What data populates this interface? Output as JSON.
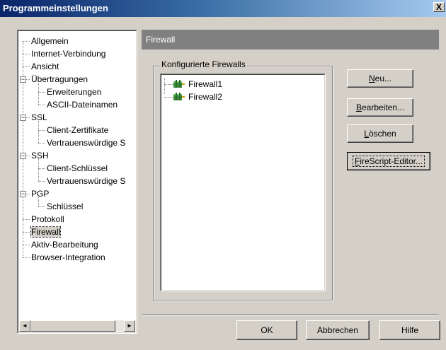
{
  "window": {
    "title": "Programmeinstellungen",
    "close_glyph": "X"
  },
  "tree": {
    "items": [
      {
        "label": "Allgemein"
      },
      {
        "label": "Internet-Verbindung"
      },
      {
        "label": "Ansicht"
      },
      {
        "label": "Übertragungen",
        "expander": "−"
      },
      {
        "label": "Erweiterungen"
      },
      {
        "label": "ASCII-Dateinamen"
      },
      {
        "label": "SSL",
        "expander": "−"
      },
      {
        "label": "Client-Zertifikate"
      },
      {
        "label": "Vertrauenswürdige S"
      },
      {
        "label": "SSH",
        "expander": "−"
      },
      {
        "label": "Client-Schlüssel"
      },
      {
        "label": "Vertrauenswürdige S"
      },
      {
        "label": "PGP",
        "expander": "−"
      },
      {
        "label": "Schlüssel"
      },
      {
        "label": "Protokoll"
      },
      {
        "label": "Firewall",
        "selected": true
      },
      {
        "label": "Aktiv-Bearbeitung"
      },
      {
        "label": "Browser-Integration"
      }
    ],
    "scroll_left_glyph": "◄",
    "scroll_right_glyph": "►"
  },
  "panel": {
    "header": "Firewall",
    "group_label": "Konfigurierte Firewalls",
    "firewalls": [
      "Firewall1",
      "Firewall2"
    ]
  },
  "side_buttons": {
    "new_first": "N",
    "new_rest": "eu...",
    "edit_first": "B",
    "edit_rest": "earbeiten...",
    "delete_first": "L",
    "delete_rest": "öschen",
    "firescript_first": "F",
    "firescript_rest": "ireScript-Editor..."
  },
  "footer": {
    "ok": "OK",
    "cancel": "Abbrechen",
    "help": "Hilfe"
  },
  "colors": {
    "title_start": "#0a246a",
    "title_end": "#a6caf0",
    "panel_header": "#808080",
    "face": "#d4d0c8"
  }
}
